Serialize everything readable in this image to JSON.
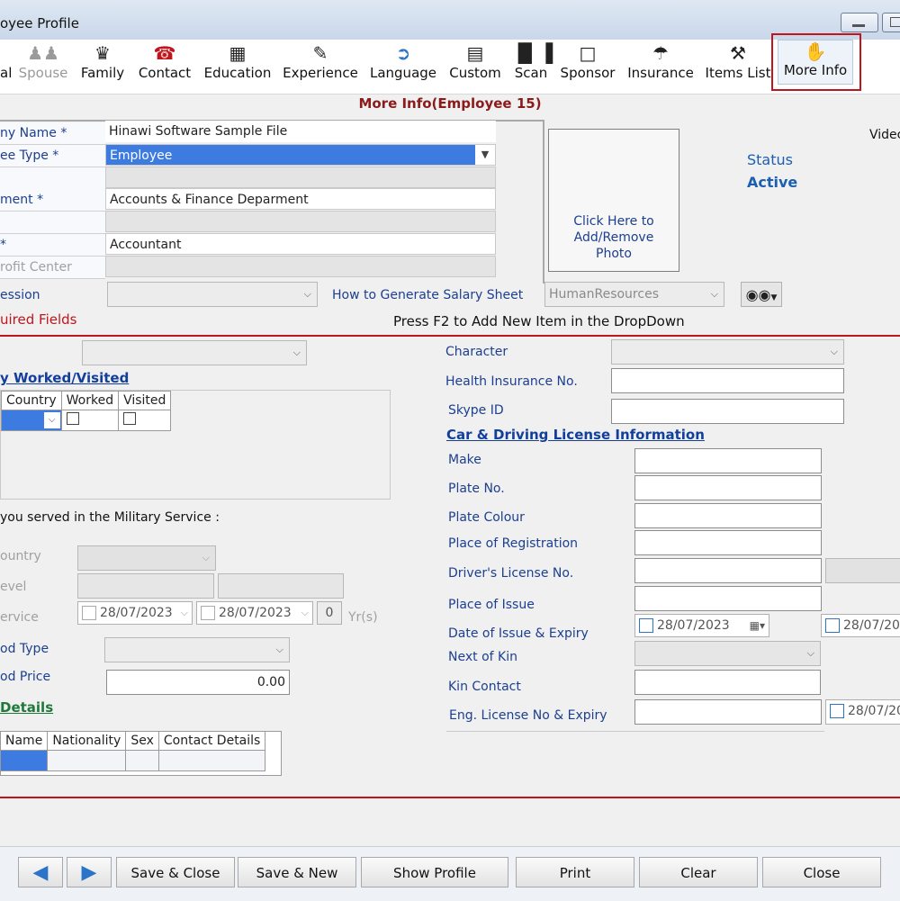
{
  "window": {
    "title": "oyee Profile"
  },
  "toolbar": {
    "items": [
      {
        "label": "al",
        "icon": "person-icon"
      },
      {
        "label": "Spouse",
        "icon": "spouse-icon"
      },
      {
        "label": "Family",
        "icon": "family-icon"
      },
      {
        "label": "Contact",
        "icon": "phone-icon"
      },
      {
        "label": "Education",
        "icon": "books-icon"
      },
      {
        "label": "Experience",
        "icon": "certificate-icon"
      },
      {
        "label": "Language",
        "icon": "language-icon"
      },
      {
        "label": "Custom",
        "icon": "custom-icon"
      },
      {
        "label": "Scan",
        "icon": "barcode-icon"
      },
      {
        "label": "Sponsor",
        "icon": "sponsor-icon"
      },
      {
        "label": "Insurance",
        "icon": "umbrella-icon"
      },
      {
        "label": "Items List",
        "icon": "tools-icon"
      },
      {
        "label": "More Info",
        "icon": "handshake-icon"
      }
    ]
  },
  "heading": "More Info(Employee 15)",
  "form": {
    "company_label": "ny Name *",
    "company_value": "Hinawi Software Sample File",
    "type_label": "ee Type *",
    "type_value": "Employee",
    "department_label": "ment *",
    "department_value": "Accounts & Finance Deparment",
    "position_label": "*",
    "position_value": "Accountant",
    "profit_center_label": "rofit Center",
    "session_label": "ession",
    "salary_link": "How to Generate Salary Sheet",
    "hr_value": "HumanResources",
    "required_label": "uired Fields",
    "press_f2": "Press F2 to Add New Item in the DropDown",
    "photo_text": "Click Here to Add/Remove Photo",
    "status_label": "Status",
    "status_value": "Active",
    "video_label": "Videc"
  },
  "left": {
    "countries_heading": "y Worked/Visited",
    "grid_headers": [
      "Country",
      "Worked",
      "Visited"
    ],
    "military_question": "you served in the Military Service :",
    "country_label": "ountry",
    "level_label": "evel",
    "service_label": "ervice",
    "date1": "28/07/2023",
    "date2": "28/07/2023",
    "years_value": "0",
    "years_unit": "Yr(s)",
    "food_type_label": "od Type",
    "food_price_label": "od Price",
    "food_price_value": "0.00",
    "details_heading": "Details",
    "details_headers": [
      "Name",
      "Nationality",
      "Sex",
      "Contact Details"
    ]
  },
  "right": {
    "character_label": "Character",
    "health_label": "Health Insurance No.",
    "skype_label": "Skype ID",
    "car_heading": "Car & Driving License Information",
    "make_label": "Make",
    "plate_no_label": "Plate No.",
    "plate_colour_label": "Plate Colour",
    "place_reg_label": "Place of Registration",
    "license_no_label": "Driver's License No.",
    "place_issue_label": "Place of Issue",
    "date_issue_label": "Date of Issue & Expiry",
    "date_issue_value": "28/07/2023",
    "date_expiry_value": "28/07/202",
    "next_kin_label": "Next of Kin",
    "kin_contact_label": "Kin Contact",
    "eng_license_label": "Eng. License No & Expiry",
    "eng_expiry_value": "28/07/20"
  },
  "buttons": {
    "save_close": "Save & Close",
    "save_new": "Save & New",
    "show_profile": "Show Profile",
    "print": "Print",
    "clear": "Clear",
    "close": "Close"
  },
  "colors": {
    "accent_red": "#c0151d",
    "link_blue": "#1c3f8f",
    "selection": "#3d7be0"
  }
}
